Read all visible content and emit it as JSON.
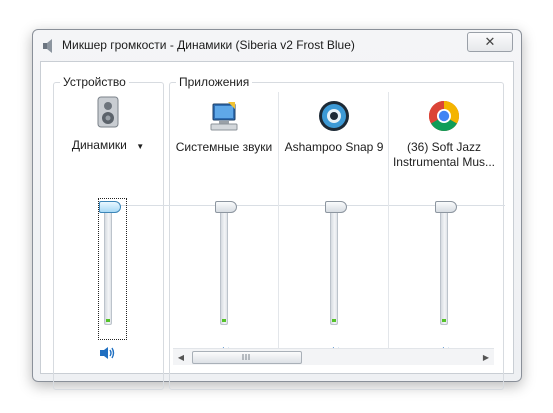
{
  "window": {
    "title": "Микшер громкости - Динамики (Siberia v2 Frost Blue)",
    "close_glyph": "✕"
  },
  "device": {
    "group_label": "Устройство",
    "name": "Динамики",
    "dropdown_glyph": "▼",
    "volume_fraction": 1.0
  },
  "apps": {
    "group_label": "Приложения",
    "channels": [
      {
        "name": "Системные звуки",
        "icon": "system-sounds-icon",
        "volume_fraction": 1.0
      },
      {
        "name": "Ashampoo Snap 9",
        "icon": "ashampoo-snap-icon",
        "volume_fraction": 1.0
      },
      {
        "name": "(36) Soft Jazz Instrumental Mus...",
        "icon": "chrome-icon",
        "volume_fraction": 1.0
      }
    ]
  },
  "scrollbar": {
    "left_glyph": "◀",
    "right_glyph": "▶"
  },
  "colors": {
    "active_thumb": "#a8d9f6",
    "level_meter": "#55c22a",
    "speaker": "#1f6fc1"
  }
}
